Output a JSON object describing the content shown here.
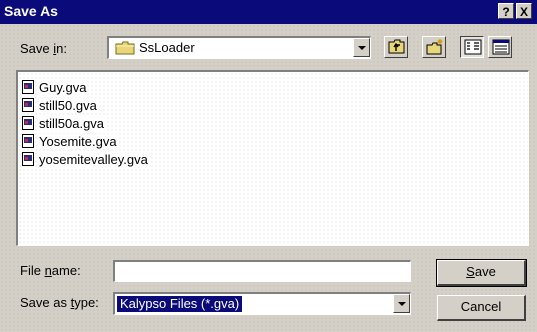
{
  "window": {
    "title": "Save As"
  },
  "titlebar_buttons": {
    "help": "?",
    "close": "X"
  },
  "save_in": {
    "label_prefix": "Save ",
    "label_underlined": "i",
    "label_suffix": "n:",
    "current_folder": "SsLoader",
    "folder_icon": "folder-icon"
  },
  "toolbar": {
    "up_icon": "up-one-level-icon",
    "new_folder_icon": "new-folder-icon",
    "list_view_icon": "list-view-icon",
    "details_view_icon": "details-view-icon"
  },
  "files": [
    {
      "name": "Guy.gva"
    },
    {
      "name": "still50.gva"
    },
    {
      "name": "still50a.gva"
    },
    {
      "name": "Yosemite.gva"
    },
    {
      "name": "yosemitevalley.gva"
    }
  ],
  "file_name": {
    "label_prefix": "File ",
    "label_underlined": "n",
    "label_suffix": "ame:",
    "value": ""
  },
  "save_type": {
    "label_prefix": "Save as ",
    "label_underlined": "t",
    "label_suffix": "ype:",
    "selected": "Kalypso Files (*.gva)"
  },
  "buttons": {
    "save_underlined": "S",
    "save_rest": "ave",
    "cancel": "Cancel"
  },
  "colors": {
    "titlebar": "#0a0a7a",
    "face": "#d4d0c8",
    "selection": "#0a0a7a"
  }
}
